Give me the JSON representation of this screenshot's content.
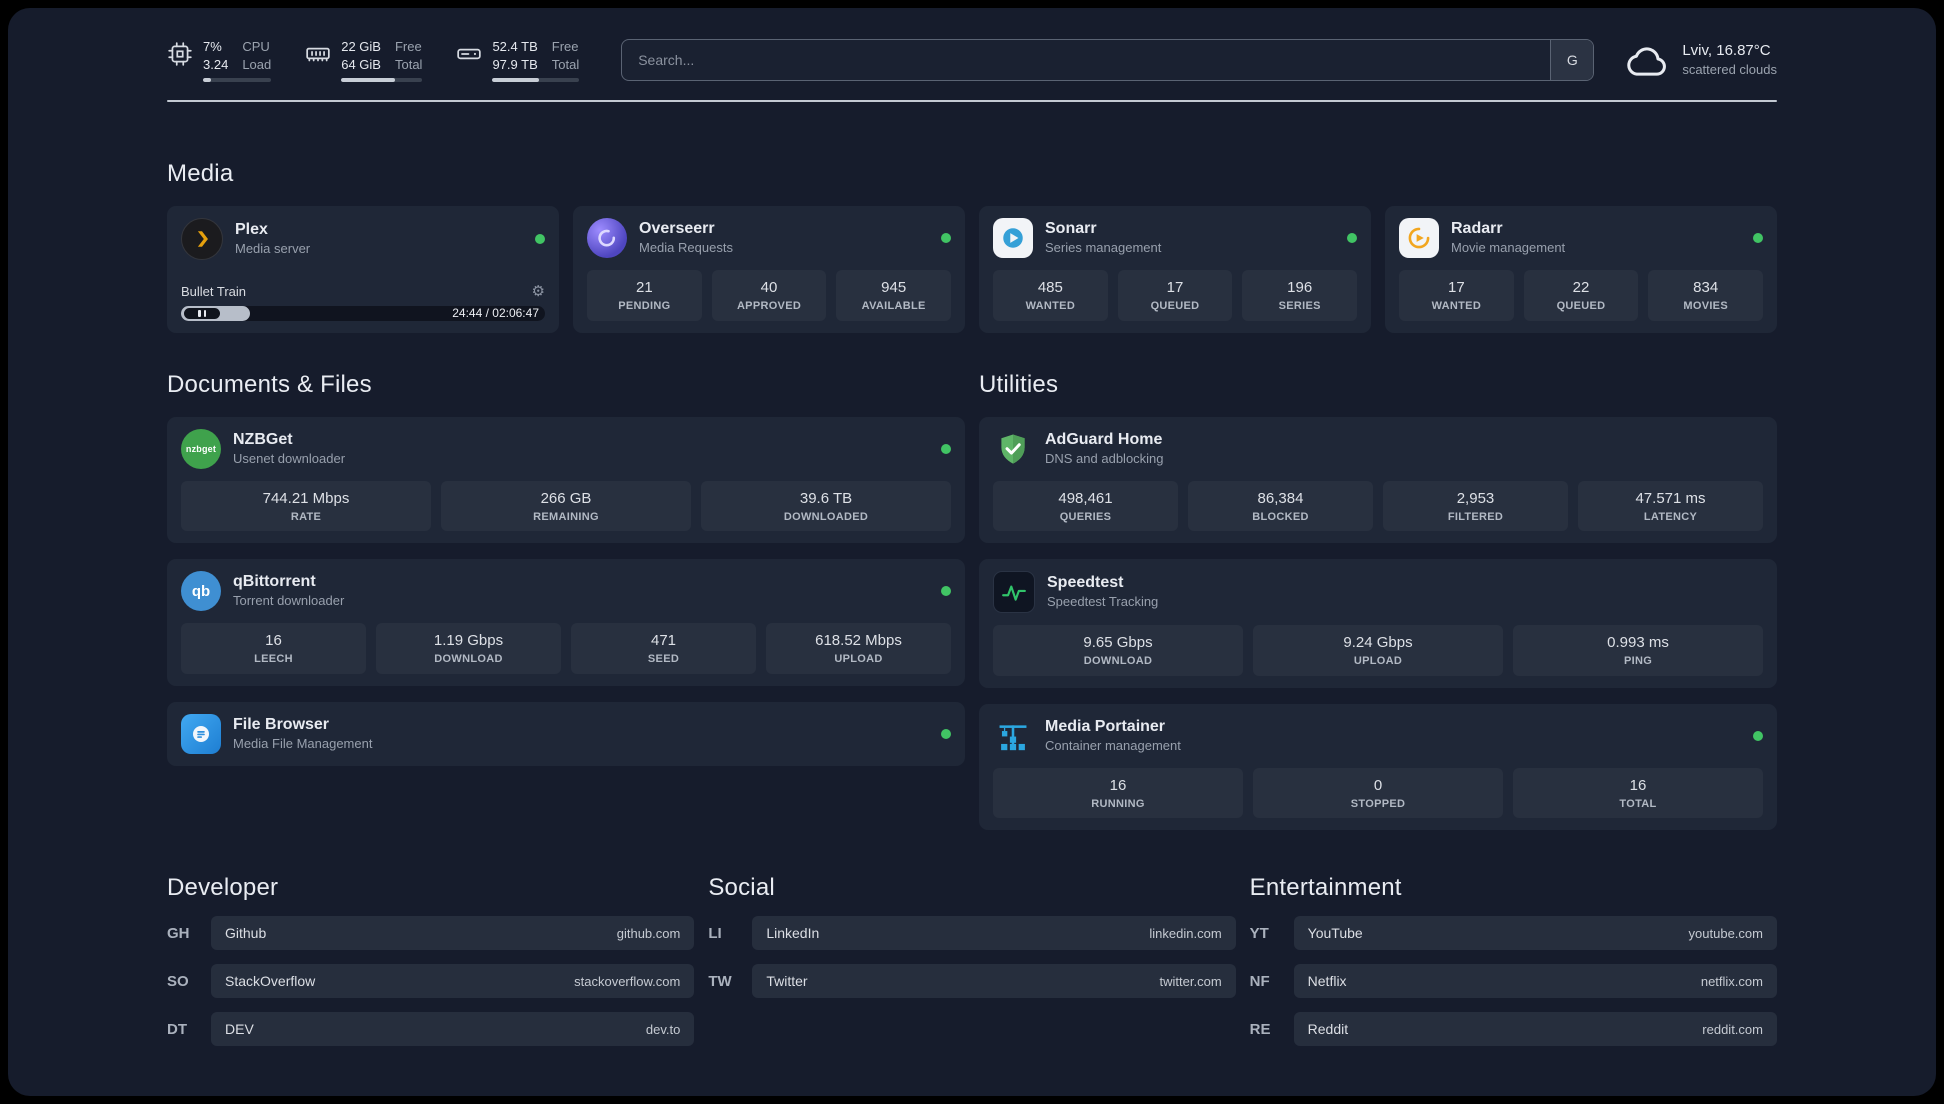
{
  "header": {
    "cpu": {
      "value_top": "7%",
      "value_bottom": "3.24",
      "label_top": "CPU",
      "label_bottom": "Load"
    },
    "memory": {
      "value_top": "22 GiB",
      "value_bottom": "64 GiB",
      "label_top": "Free",
      "label_bottom": "Total"
    },
    "disk": {
      "value_top": "52.4 TB",
      "value_bottom": "97.9 TB",
      "label_top": "Free",
      "label_bottom": "Total"
    },
    "search": {
      "placeholder": "Search...",
      "button_label": "G"
    },
    "weather": {
      "location": "Lviv, 16.87°C",
      "condition": "scattered clouds"
    }
  },
  "sections": {
    "media": {
      "title": "Media"
    },
    "documents": {
      "title": "Documents & Files"
    },
    "utilities": {
      "title": "Utilities"
    }
  },
  "media_cards": {
    "plex": {
      "name": "Plex",
      "subtitle": "Media server",
      "track": "Bullet Train",
      "time": "24:44 / 02:06:47"
    },
    "overseerr": {
      "name": "Overseerr",
      "subtitle": "Media Requests",
      "stats": [
        {
          "value": "21",
          "label": "PENDING"
        },
        {
          "value": "40",
          "label": "APPROVED"
        },
        {
          "value": "945",
          "label": "AVAILABLE"
        }
      ]
    },
    "sonarr": {
      "name": "Sonarr",
      "subtitle": "Series management",
      "stats": [
        {
          "value": "485",
          "label": "WANTED"
        },
        {
          "value": "17",
          "label": "QUEUED"
        },
        {
          "value": "196",
          "label": "SERIES"
        }
      ]
    },
    "radarr": {
      "name": "Radarr",
      "subtitle": "Movie management",
      "stats": [
        {
          "value": "17",
          "label": "WANTED"
        },
        {
          "value": "22",
          "label": "QUEUED"
        },
        {
          "value": "834",
          "label": "MOVIES"
        }
      ]
    }
  },
  "document_cards": {
    "nzbget": {
      "name": "NZBGet",
      "subtitle": "Usenet downloader",
      "icon_text": "nzbget",
      "stats": [
        {
          "value": "744.21 Mbps",
          "label": "RATE"
        },
        {
          "value": "266 GB",
          "label": "REMAINING"
        },
        {
          "value": "39.6 TB",
          "label": "DOWNLOADED"
        }
      ]
    },
    "qbittorrent": {
      "name": "qBittorrent",
      "subtitle": "Torrent downloader",
      "icon_text": "qb",
      "stats": [
        {
          "value": "16",
          "label": "LEECH"
        },
        {
          "value": "1.19 Gbps",
          "label": "DOWNLOAD"
        },
        {
          "value": "471",
          "label": "SEED"
        },
        {
          "value": "618.52 Mbps",
          "label": "UPLOAD"
        }
      ]
    },
    "filebrowser": {
      "name": "File Browser",
      "subtitle": "Media File Management"
    }
  },
  "utility_cards": {
    "adguard": {
      "name": "AdGuard Home",
      "subtitle": "DNS and adblocking",
      "stats": [
        {
          "value": "498,461",
          "label": "QUERIES"
        },
        {
          "value": "86,384",
          "label": "BLOCKED"
        },
        {
          "value": "2,953",
          "label": "FILTERED"
        },
        {
          "value": "47.571 ms",
          "label": "LATENCY"
        }
      ]
    },
    "speedtest": {
      "name": "Speedtest",
      "subtitle": "Speedtest Tracking",
      "stats": [
        {
          "value": "9.65 Gbps",
          "label": "DOWNLOAD"
        },
        {
          "value": "9.24 Gbps",
          "label": "UPLOAD"
        },
        {
          "value": "0.993 ms",
          "label": "PING"
        }
      ]
    },
    "portainer": {
      "name": "Media Portainer",
      "subtitle": "Container management",
      "stats": [
        {
          "value": "16",
          "label": "RUNNING"
        },
        {
          "value": "0",
          "label": "STOPPED"
        },
        {
          "value": "16",
          "label": "TOTAL"
        }
      ]
    }
  },
  "links": {
    "developer": {
      "title": "Developer",
      "items": [
        {
          "abbr": "GH",
          "name": "Github",
          "url": "github.com"
        },
        {
          "abbr": "SO",
          "name": "StackOverflow",
          "url": "stackoverflow.com"
        },
        {
          "abbr": "DT",
          "name": "DEV",
          "url": "dev.to"
        }
      ]
    },
    "social": {
      "title": "Social",
      "items": [
        {
          "abbr": "LI",
          "name": "LinkedIn",
          "url": "linkedin.com"
        },
        {
          "abbr": "TW",
          "name": "Twitter",
          "url": "twitter.com"
        }
      ]
    },
    "entertainment": {
      "title": "Entertainment",
      "items": [
        {
          "abbr": "YT",
          "name": "YouTube",
          "url": "youtube.com"
        },
        {
          "abbr": "NF",
          "name": "Netflix",
          "url": "netflix.com"
        },
        {
          "abbr": "RE",
          "name": "Reddit",
          "url": "reddit.com"
        }
      ]
    }
  },
  "colors": {
    "status_online": "#41c464",
    "accent_plex": "#e5a00d",
    "divider": "#c3c9d2"
  }
}
